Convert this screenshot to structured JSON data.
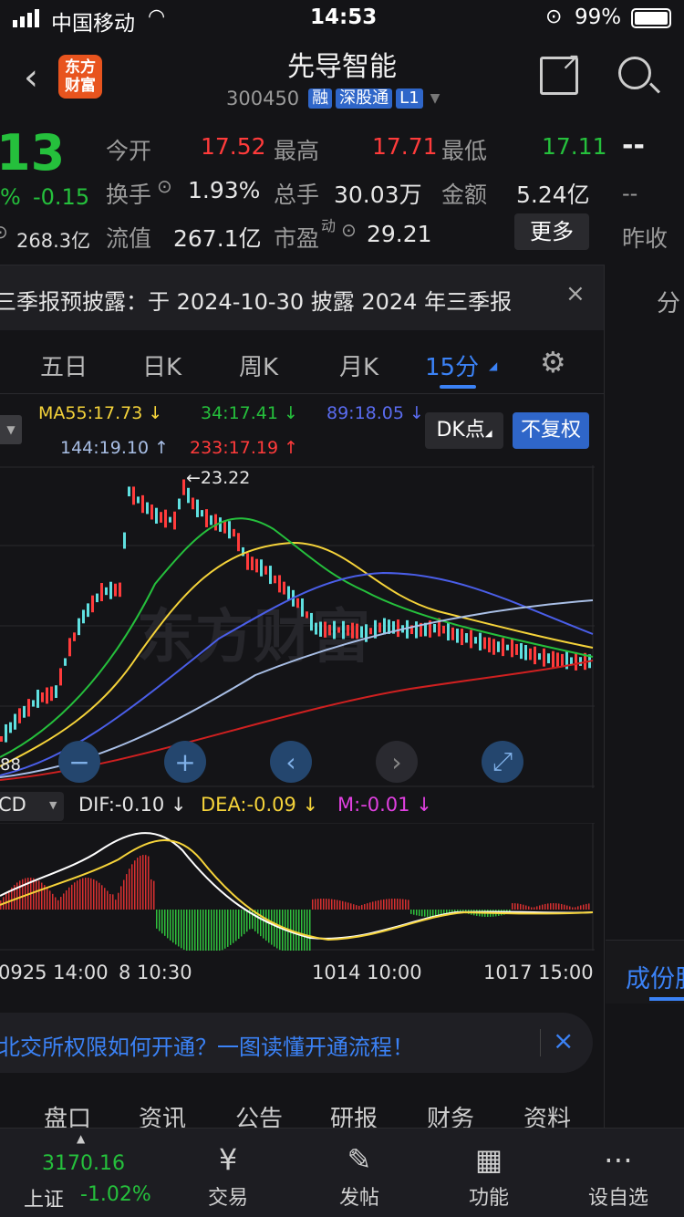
{
  "status": {
    "carrier": "中国移动",
    "time": "14:53",
    "battery": "99%"
  },
  "header": {
    "brand_logo": "东方财富",
    "title": "先导智能",
    "code": "300450",
    "badges": [
      "融",
      "深股通",
      "L1"
    ]
  },
  "quote": {
    "price_partial": "13",
    "pct_partial": "%",
    "change": "-0.15",
    "market_cap_partial": "268.3亿",
    "open_label": "今开",
    "open": "17.52",
    "high_label": "最高",
    "high": "17.71",
    "low_label": "最低",
    "low": "17.11",
    "dash1": "--",
    "turnover_label": "换手",
    "turnover": "1.93%",
    "volume_label": "总手",
    "volume": "30.03万",
    "amount_label": "金额",
    "amount": "5.24亿",
    "dash2": "--",
    "float_label": "流值",
    "float_value": "267.1亿",
    "pe_label": "市盈",
    "pe_sup": "动",
    "pe": "29.21",
    "more_btn": "更多",
    "prev_close_label": "昨收"
  },
  "notice": {
    "text": "三季报预披露：于 2024-10-30 披露 2024 年三季报",
    "right_label": "分"
  },
  "period_tabs": [
    "五日",
    "日K",
    "周K",
    "月K",
    "15分"
  ],
  "chart_controls": {
    "dk_label": "DK点",
    "adj_label": "不复权"
  },
  "ma_legend": {
    "ma55": "MA55:17.73 ↓",
    "ma34": "34:17.41 ↓",
    "ma89": "89:18.05 ↓",
    "ma144": "144:19.10 ↑",
    "ma233": "233:17.19 ↑"
  },
  "price_annotation": "23.22",
  "left_price_partial": "88",
  "macd": {
    "selector_partial": "CD",
    "dif": "DIF:-0.10 ↓",
    "dea": "DEA:-0.09 ↓",
    "m": "M:-0.01 ↓"
  },
  "time_axis": [
    "0925 14:00",
    "8 10:30",
    "1014 10:00",
    "1017 15:00"
  ],
  "side_tab": "成份股",
  "ad_banner": "北交所权限如何开通？一图读懂开通流程！",
  "detail_tabs": [
    "盘口",
    "资讯",
    "公告",
    "研报",
    "财务",
    "资料"
  ],
  "bottom_nav": {
    "index_value": "3170.16",
    "index_name": "上证",
    "index_change": "-1.02%",
    "items": [
      "交易",
      "发帖",
      "功能",
      "设自选"
    ]
  },
  "colors": {
    "up": "#ff3b3b",
    "down": "#25c03c",
    "accent": "#3b82f6",
    "bg": "#141417"
  }
}
